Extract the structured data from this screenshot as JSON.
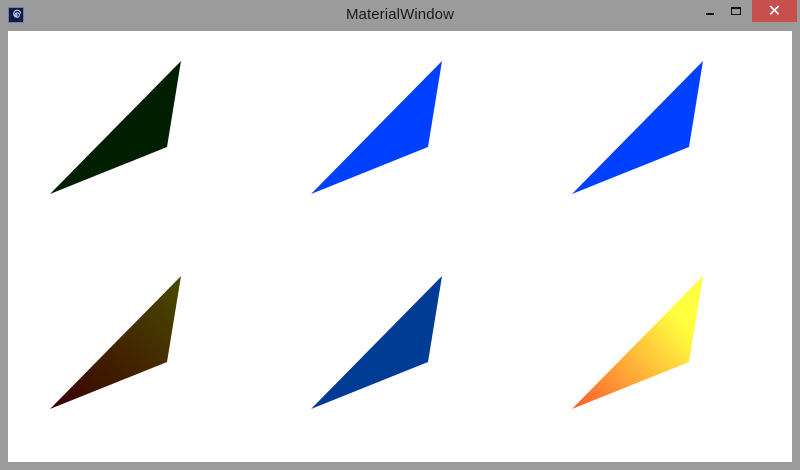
{
  "window": {
    "title": "MaterialWindow",
    "close_glyph": "✕"
  },
  "icons": {
    "app": "spiral-app-icon",
    "minimize": "minimize-icon",
    "maximize": "maximize-icon",
    "close": "close-icon"
  },
  "colors": {
    "frame": "#9b9b9b",
    "close_button": "#c7504f",
    "client_background": "#ffffff"
  },
  "triangles": [
    {
      "id": "dark-green",
      "fill": "#001e00"
    },
    {
      "id": "bright-blue-1",
      "fill": "#0040ff"
    },
    {
      "id": "bright-blue-2",
      "fill": "#0040ff"
    },
    {
      "id": "maroon-olive-gradient",
      "gradient": [
        "#3a0000",
        "#4a4a00"
      ]
    },
    {
      "id": "navy-blue",
      "fill": "#003c96"
    },
    {
      "id": "orange-yellow-gradient",
      "gradient": [
        "#ff5a2e",
        "#ffff40"
      ]
    }
  ]
}
